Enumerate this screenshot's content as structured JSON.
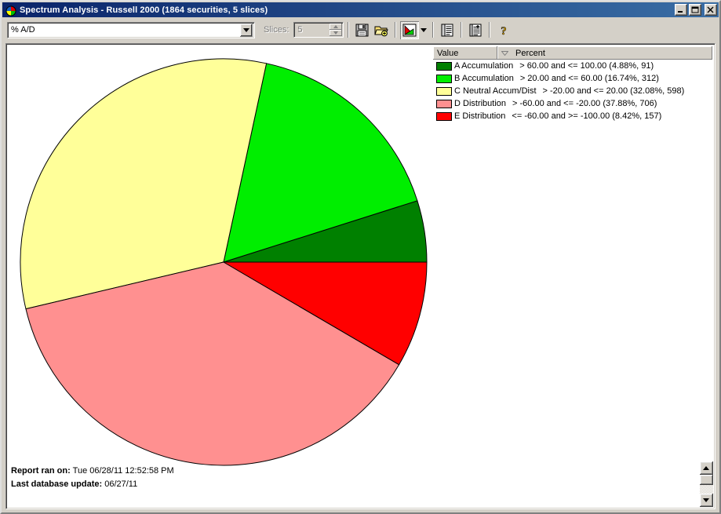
{
  "window": {
    "title": "Spectrum Analysis - Russell 2000 (1864 securities, 5 slices)",
    "icon": "pie-chart-icon",
    "minimize_label": "_",
    "maximize_label": "□",
    "close_label": "✕"
  },
  "toolbar": {
    "metric_combo": {
      "value": "% A/D",
      "placeholder": "% A/D",
      "options": [
        "% A/D"
      ]
    },
    "slices_label": "Slices:",
    "slices_value": "5",
    "buttons": [
      {
        "name": "save-button",
        "icon": "floppy-disk-icon",
        "label": "Save"
      },
      {
        "name": "open-button",
        "icon": "open-folder-add-icon",
        "label": "Open"
      },
      {
        "name": "pie-chart-view-button",
        "icon": "pie-chart-icon",
        "label": "Pie Chart View",
        "pressed": true
      },
      {
        "name": "pie-chart-dropdown-button",
        "icon": "chevron-down-icon",
        "label": "Chart Type"
      },
      {
        "name": "report-view-button",
        "icon": "list-report-icon",
        "label": "Report View"
      },
      {
        "name": "report-add-button",
        "icon": "report-add-icon",
        "label": "Add Report"
      },
      {
        "name": "help-button",
        "icon": "question-mark-icon",
        "label": "Help"
      }
    ]
  },
  "legend": {
    "columns": [
      "Value",
      "Percent"
    ],
    "sort_indicator": "descending",
    "rows": [
      {
        "color": "#008000",
        "name": "A Accumulation",
        "desc": "> 60.00 and <= 100.00 (4.88%, 91)"
      },
      {
        "color": "#00EE00",
        "name": "B Accumulation",
        "desc": "> 20.00 and <= 60.00 (16.74%, 312)"
      },
      {
        "color": "#FFFF99",
        "name": "C Neutral Accum/Dist",
        "desc": "> -20.00 and <= 20.00 (32.08%, 598)"
      },
      {
        "color": "#FF9090",
        "name": "D Distribution",
        "desc": "> -60.00 and <= -20.00 (37.88%, 706)"
      },
      {
        "color": "#FF0000",
        "name": "E Distribution",
        "desc": "<= -60.00 and >= -100.00 (8.42%, 157)"
      }
    ]
  },
  "footer": {
    "report_ran_label": "Report ran on:",
    "report_ran_value": "Tue 06/28/11 12:52:58 PM",
    "last_update_label": "Last database update:",
    "last_update_value": "06/27/11"
  },
  "chart_data": {
    "type": "pie",
    "title": "Spectrum Analysis - Russell 2000",
    "total_securities": 1864,
    "slice_count": 5,
    "start_angle_deg": 0,
    "direction": "counterclockwise",
    "categories": [
      "A Accumulation",
      "B Accumulation",
      "C Neutral Accum/Dist",
      "D Distribution",
      "E Distribution"
    ],
    "values": [
      4.88,
      16.74,
      32.08,
      37.88,
      8.42
    ],
    "counts": [
      91,
      312,
      598,
      706,
      157
    ],
    "colors": [
      "#008000",
      "#00EE00",
      "#FFFF99",
      "#FF9090",
      "#FF0000"
    ],
    "ranges": [
      "> 60.00 and <= 100.00",
      "> 20.00 and <= 60.00",
      "> -20.00 and <= 20.00",
      "> -60.00 and <= -20.00",
      "<= -60.00 and >= -100.00"
    ],
    "legend_position": "right",
    "grid": false,
    "xlabel": "",
    "ylabel": ""
  }
}
